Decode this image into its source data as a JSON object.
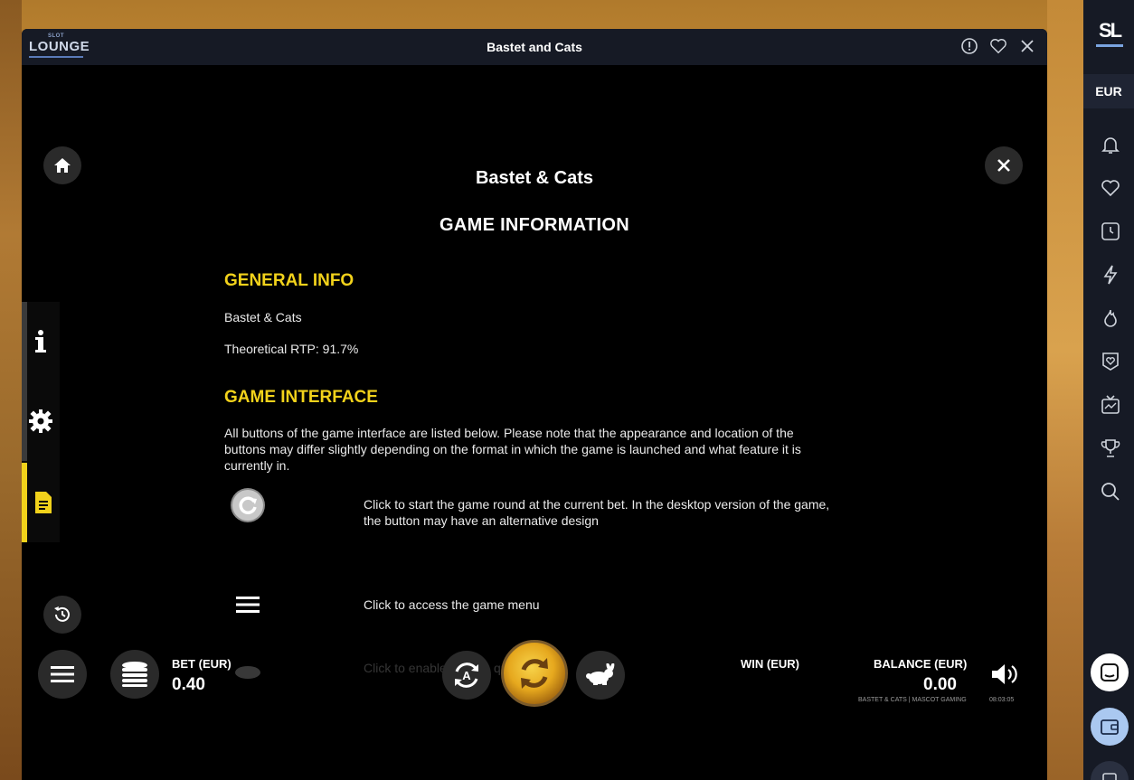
{
  "window": {
    "title": "Bastet and Cats",
    "logo_top": "SLOT",
    "logo_main": "LOUNGE"
  },
  "info": {
    "game_title": "Bastet & Cats",
    "heading": "GAME INFORMATION",
    "general": {
      "heading": "GENERAL INFO",
      "name": "Bastet & Cats",
      "rtp": "Theoretical RTP: 91.7%"
    },
    "interface": {
      "heading": "GAME INTERFACE",
      "intro": "All buttons of the game interface are listed below. Please note that the appearance and location of the buttons may differ slightly depending on the format in which the game is launched and what feature it is currently in.",
      "rows": [
        {
          "icon": "spin-icon",
          "text": "Click to start the game round at the current bet. In the desktop version of the game, the button may have an alternative design"
        },
        {
          "icon": "menu-icon",
          "text": "Click to access the game menu"
        },
        {
          "icon": "rabbit-icon",
          "text": "Click to enable/disable quick spin"
        }
      ]
    }
  },
  "bottom": {
    "bet_label": "BET (EUR)",
    "bet_value": "0.40",
    "win_label": "WIN (EUR)",
    "balance_label": "BALANCE (EUR)",
    "balance_value": "0.00",
    "provider": "BASTET & CATS | MASCOT GAMING",
    "clock": "08:03:05"
  },
  "sidebar": {
    "currency": "EUR",
    "logo": "SL"
  },
  "colors": {
    "accent": "#f2d21b",
    "panel": "#161a25"
  }
}
